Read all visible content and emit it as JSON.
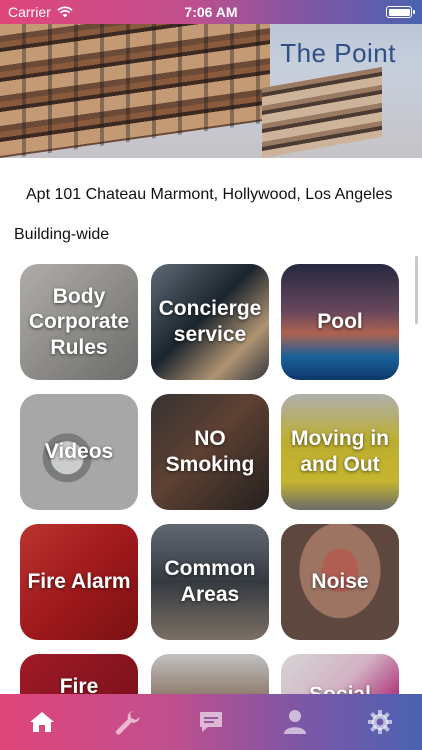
{
  "status_bar": {
    "carrier": "Carrier",
    "time": "7:06 AM",
    "battery_level": 1.0
  },
  "header": {
    "brand": "The Point"
  },
  "address": "Apt 101 Chateau Marmont, Hollywood, Los Angeles",
  "section_title": "Building-wide",
  "tiles": [
    {
      "label": "Body Corporate Rules",
      "icon": "documents-photo"
    },
    {
      "label": "Concierge service",
      "icon": "concierge-photo"
    },
    {
      "label": "Pool",
      "icon": "pool-photo"
    },
    {
      "label": "Videos",
      "icon": "camera-photo"
    },
    {
      "label": "NO Smoking",
      "icon": "smoking-photo"
    },
    {
      "label": "Moving in and Out",
      "icon": "moving-truck-photo"
    },
    {
      "label": "Fire Alarm",
      "icon": "fire-alarm-photo"
    },
    {
      "label": "Common Areas",
      "icon": "common-areas-photo"
    },
    {
      "label": "Noise",
      "icon": "noise-photo"
    },
    {
      "label": "Fire",
      "icon": "fire-photo"
    },
    {
      "label": "",
      "icon": "person-photo"
    },
    {
      "label": "Social",
      "icon": "social-photo"
    }
  ],
  "tab_bar": {
    "items": [
      {
        "icon": "home-icon"
      },
      {
        "icon": "wrench-icon"
      },
      {
        "icon": "chat-icon"
      },
      {
        "icon": "profile-icon"
      },
      {
        "icon": "gear-icon"
      }
    ],
    "active_index": 0
  },
  "colors": {
    "gradient_start": "#e0457a",
    "gradient_end": "#4a62b2",
    "brand_text": "#2f4f86"
  }
}
